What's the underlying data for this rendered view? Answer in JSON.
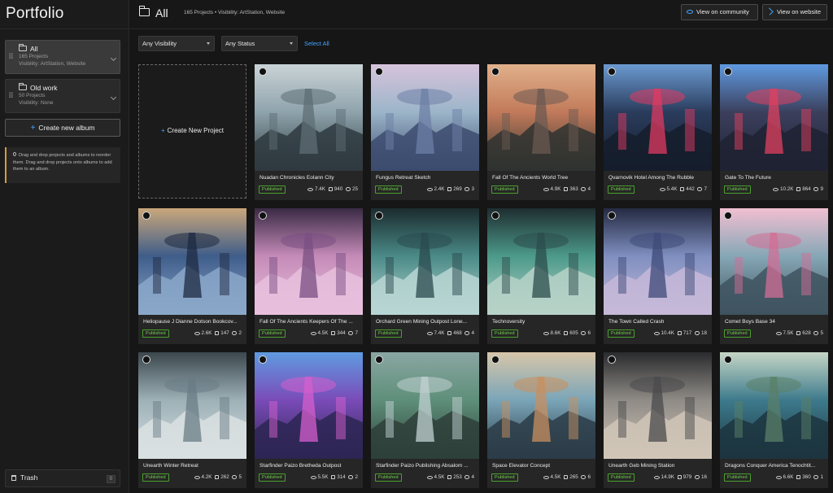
{
  "sidebar": {
    "title": "Portfolio",
    "albums": [
      {
        "name": "All",
        "meta1": "165 Projects",
        "meta2": "Visibility: ArtStation, Website"
      },
      {
        "name": "Old work",
        "meta1": "50 Projects",
        "meta2": "Visibility: None"
      }
    ],
    "create_album": "Create new album",
    "tip": "Drag and drop projects and albums to reorder them. Drag and drop projects onto albums to add them to an album.",
    "trash": {
      "label": "Trash",
      "count": "0"
    }
  },
  "header": {
    "title": "All",
    "meta": "165 Projects  •  Visibility: ArtStation, Website",
    "view_community": "View on community",
    "view_website": "View on website"
  },
  "filters": {
    "visibility": "Any Visibility",
    "status": "Any Status",
    "select_all": "Select All"
  },
  "create_project": "Create New Project",
  "colors": {
    "accent": "#43a3ff",
    "published": "#6fcf4a",
    "tip_border": "#d79b3b"
  },
  "projects": [
    {
      "title": "Nuadan Chronicles Eolann City",
      "status": "Published",
      "views": "7.4K",
      "likes": "940",
      "comments": "25",
      "palette": [
        "#8fa3ac",
        "#5d6d74",
        "#2e3a3f",
        "#c9d3d6"
      ]
    },
    {
      "title": "Fungus Retreat Sketch",
      "status": "Published",
      "views": "2.4K",
      "likes": "269",
      "comments": "3",
      "palette": [
        "#9cb5c9",
        "#6c7fa6",
        "#3c4b6e",
        "#d7c3dc"
      ]
    },
    {
      "title": "Fall Of The Ancients World Tree",
      "status": "Published",
      "views": "4.9K",
      "likes": "363",
      "comments": "4",
      "palette": [
        "#c17a5a",
        "#6b5a52",
        "#2f3330",
        "#e1b08a"
      ]
    },
    {
      "title": "Qvarnovik Hotel Among The Rubble",
      "status": "Published",
      "views": "5.4K",
      "likes": "442",
      "comments": "7",
      "palette": [
        "#2a3c5c",
        "#e03a62",
        "#151d2c",
        "#6b9ad1"
      ]
    },
    {
      "title": "Gate To The Future",
      "status": "Published",
      "views": "10.2K",
      "likes": "864",
      "comments": "9",
      "palette": [
        "#3b3f5c",
        "#e0405f",
        "#1e2233",
        "#5f9ae0"
      ]
    },
    {
      "title": "Heliopause J Dianne Dotson Bookcov...",
      "status": "Published",
      "views": "2.6K",
      "likes": "147",
      "comments": "2",
      "palette": [
        "#3f5d8a",
        "#1d2a42",
        "#8aa7c9",
        "#c9a77a"
      ]
    },
    {
      "title": "Fall Of The Ancients Keepers Of The ...",
      "status": "Published",
      "views": "4.5K",
      "likes": "344",
      "comments": "7",
      "palette": [
        "#c58bb8",
        "#7a4f83",
        "#e7c0dd",
        "#3a2a45"
      ]
    },
    {
      "title": "Orchard Green Mining Outpost Lone...",
      "status": "Published",
      "views": "7.4K",
      "likes": "468",
      "comments": "4",
      "palette": [
        "#4a8a87",
        "#2a4a4e",
        "#b8d6d3",
        "#1b2b2e"
      ]
    },
    {
      "title": "Technoversity",
      "status": "Published",
      "views": "8.6K",
      "likes": "605",
      "comments": "6",
      "palette": [
        "#4c9a8a",
        "#2b4c4c",
        "#b7d2c8",
        "#1e2d30"
      ]
    },
    {
      "title": "The Town Called Crash",
      "status": "Published",
      "views": "10.4K",
      "likes": "717",
      "comments": "18",
      "palette": [
        "#7f8fc0",
        "#3e4a78",
        "#c6b9d8",
        "#242a42"
      ]
    },
    {
      "title": "Comet Boys Base 34",
      "status": "Published",
      "views": "7.5K",
      "likes": "628",
      "comments": "5",
      "palette": [
        "#86a7b6",
        "#d26d96",
        "#3f5360",
        "#f1bfd1"
      ]
    },
    {
      "title": "Unearth Winter Retreat",
      "status": "Published",
      "views": "4.2K",
      "likes": "262",
      "comments": "5",
      "palette": [
        "#9db1b7",
        "#6a7c85",
        "#d9e0e2",
        "#3b474d"
      ]
    },
    {
      "title": "Starfinder Paizo Bretheda Outpost",
      "status": "Published",
      "views": "5.5K",
      "likes": "314",
      "comments": "2",
      "palette": [
        "#7a4bb8",
        "#d65fce",
        "#2d2653",
        "#5f9be0"
      ]
    },
    {
      "title": "Starfinder Paizo Publishing Absalom ...",
      "status": "Published",
      "views": "4.5K",
      "likes": "253",
      "comments": "4",
      "palette": [
        "#5e8f7a",
        "#c1d1d1",
        "#2e3f3a",
        "#8aa6a2"
      ]
    },
    {
      "title": "Space Elevator Concept",
      "status": "Published",
      "views": "4.5K",
      "likes": "265",
      "comments": "6",
      "palette": [
        "#7aa5b8",
        "#c88f5f",
        "#2b3c48",
        "#d7c6a9"
      ]
    },
    {
      "title": "Unearth Geb Mining Station",
      "status": "Published",
      "views": "14.9K",
      "likes": "979",
      "comments": "16",
      "palette": [
        "#8f8b86",
        "#4a4a4c",
        "#d0c6b7",
        "#2a2b2e"
      ]
    },
    {
      "title": "Dragons Conquer America Tenochtit...",
      "status": "Published",
      "views": "6.6K",
      "likes": "360",
      "comments": "1",
      "palette": [
        "#3d7a8c",
        "#5a7f68",
        "#1c3540",
        "#c5d6c5"
      ]
    }
  ]
}
